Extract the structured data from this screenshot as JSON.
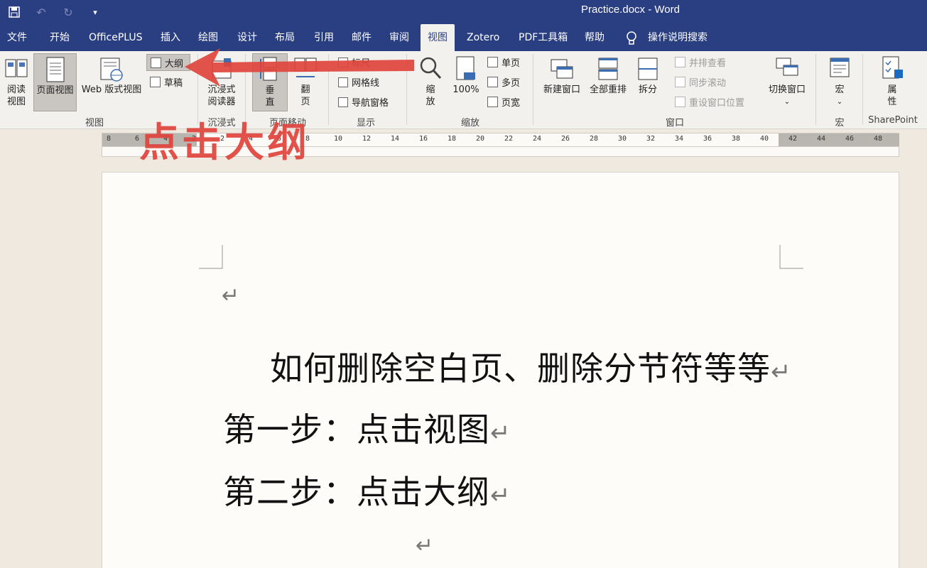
{
  "titlebar": {
    "title": "Practice.docx - Word",
    "qat": [
      "save-icon",
      "undo-icon",
      "redo-icon",
      "customize-icon"
    ]
  },
  "tabs": [
    "文件",
    "开始",
    "OfficePLUS",
    "插入",
    "绘图",
    "设计",
    "布局",
    "引用",
    "邮件",
    "审阅",
    "视图",
    "Zotero",
    "PDF工具箱",
    "帮助",
    "操作说明搜索"
  ],
  "active_tab": "视图",
  "ribbon": {
    "views": {
      "read_mode": "阅读\n视图",
      "print_layout": "页面视图",
      "web_layout": "Web 版式视图",
      "outline": "大纲",
      "draft": "草稿",
      "label": "视图"
    },
    "immersive": {
      "reader": "沉浸式\n阅读器",
      "label": "沉浸式"
    },
    "page_move": {
      "vertical": "垂\n直",
      "side_to_side": "翻\n页",
      "label": "页面移动"
    },
    "show": {
      "ruler": "标尺",
      "gridlines": "网格线",
      "nav_pane": "导航窗格",
      "label": "显示"
    },
    "zoom": {
      "zoom": "缩\n放",
      "hundred": "100%",
      "one_page": "单页",
      "multi_page": "多页",
      "page_width": "页宽",
      "label": "缩放"
    },
    "window": {
      "new_window": "新建窗口",
      "arrange_all": "全部重排",
      "split": "拆分",
      "side_by_side": "并排查看",
      "sync_scroll": "同步滚动",
      "reset_position": "重设窗口位置",
      "switch_windows": "切换窗口",
      "label": "窗口"
    },
    "macros": {
      "macros": "宏",
      "label": "宏"
    },
    "sharepoint": {
      "properties": "属\n性",
      "label": "SharePoint"
    }
  },
  "ruler": {
    "ticks": [
      "8",
      "6",
      "4",
      "2",
      "2",
      "4",
      "6",
      "8",
      "10",
      "12",
      "14",
      "16",
      "18",
      "20",
      "22",
      "24",
      "26",
      "28",
      "30",
      "32",
      "34",
      "36",
      "38",
      "40",
      "42",
      "44",
      "46",
      "48"
    ]
  },
  "document": {
    "lines": [
      "如何删除空白页、删除分节符等等",
      "第一步：点击视图",
      "第二步：点击大纲"
    ],
    "para_mark": "↵"
  },
  "annotation": {
    "text": "点击大纲",
    "color": "#e0443c"
  },
  "colors": {
    "titlebar": "#2a3e82",
    "ribbon": "#f3f1ee",
    "page": "#fdfcf8"
  }
}
